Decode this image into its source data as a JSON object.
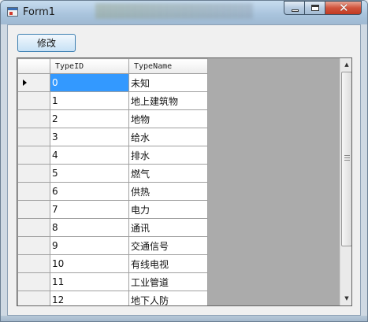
{
  "window": {
    "title": "Form1"
  },
  "toolbar": {
    "edit_label": "修改"
  },
  "grid": {
    "columns": [
      "TypeID",
      "TypeName"
    ],
    "rows": [
      {
        "id": "0",
        "name": "未知"
      },
      {
        "id": "1",
        "name": "地上建筑物"
      },
      {
        "id": "2",
        "name": "地物"
      },
      {
        "id": "3",
        "name": "给水"
      },
      {
        "id": "4",
        "name": "排水"
      },
      {
        "id": "5",
        "name": "燃气"
      },
      {
        "id": "6",
        "name": "供热"
      },
      {
        "id": "7",
        "name": "电力"
      },
      {
        "id": "8",
        "name": "通讯"
      },
      {
        "id": "9",
        "name": "交通信号"
      },
      {
        "id": "10",
        "name": "有线电视"
      },
      {
        "id": "11",
        "name": "工业管道"
      },
      {
        "id": "12",
        "name": "地下人防"
      }
    ],
    "selected_row": 0
  },
  "colors": {
    "selection": "#3399ff",
    "grid_background": "#ababab"
  },
  "icons": {
    "app": "form-icon",
    "minimize": "minimize-icon",
    "maximize": "maximize-icon",
    "close": "close-icon",
    "scroll_up": "scroll-up-arrow-icon",
    "scroll_down": "scroll-down-arrow-icon",
    "current_row": "row-pointer-icon"
  }
}
